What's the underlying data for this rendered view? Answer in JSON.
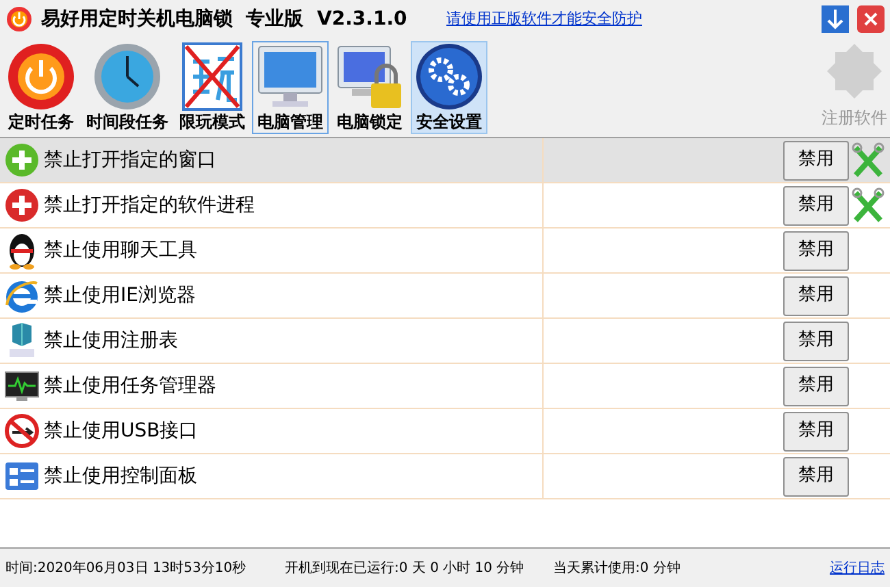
{
  "window": {
    "title": "易好用定时关机电脑锁  专业版  V2.3.1.0",
    "link": "请使用正版软件才能安全防护"
  },
  "toolbar": [
    {
      "label": "定时任务",
      "kind": "power",
      "selected": false,
      "hovered": false
    },
    {
      "label": "时间段任务",
      "kind": "clock",
      "selected": false,
      "hovered": false
    },
    {
      "label": "限玩模式",
      "kind": "play",
      "selected": false,
      "hovered": false
    },
    {
      "label": "电脑管理",
      "kind": "monitor",
      "selected": true,
      "hovered": false
    },
    {
      "label": "电脑锁定",
      "kind": "lock",
      "selected": false,
      "hovered": false
    },
    {
      "label": "安全设置",
      "kind": "gears",
      "selected": false,
      "hovered": true
    }
  ],
  "register": {
    "label": "注册软件",
    "disabled": true
  },
  "rows": [
    {
      "kind": "plus-green",
      "label": "禁止打开指定的窗口",
      "button": "禁用",
      "selected": true,
      "tools": true
    },
    {
      "kind": "plus-red",
      "label": "禁止打开指定的软件进程",
      "button": "禁用",
      "selected": false,
      "tools": true
    },
    {
      "kind": "penguin",
      "label": "禁止使用聊天工具",
      "button": "禁用",
      "selected": false,
      "tools": false
    },
    {
      "kind": "browser",
      "label": "禁止使用IE浏览器",
      "button": "禁用",
      "selected": false,
      "tools": false
    },
    {
      "kind": "cubes",
      "label": "禁止使用注册表",
      "button": "禁用",
      "selected": false,
      "tools": false
    },
    {
      "kind": "monitor",
      "label": "禁止使用任务管理器",
      "button": "禁用",
      "selected": false,
      "tools": false
    },
    {
      "kind": "usb",
      "label": "禁止使用USB接口",
      "button": "禁用",
      "selected": false,
      "tools": false
    },
    {
      "kind": "panel",
      "label": "禁止使用控制面板",
      "button": "禁用",
      "selected": false,
      "tools": false
    }
  ],
  "status_bar": {
    "time": "时间:2020年06月03日 13时53分10秒",
    "uptime": "开机到现在已运行:0 天 0 小时 10 分钟",
    "today": "当天累计使用:0 分钟",
    "log_link": "运行日志"
  }
}
